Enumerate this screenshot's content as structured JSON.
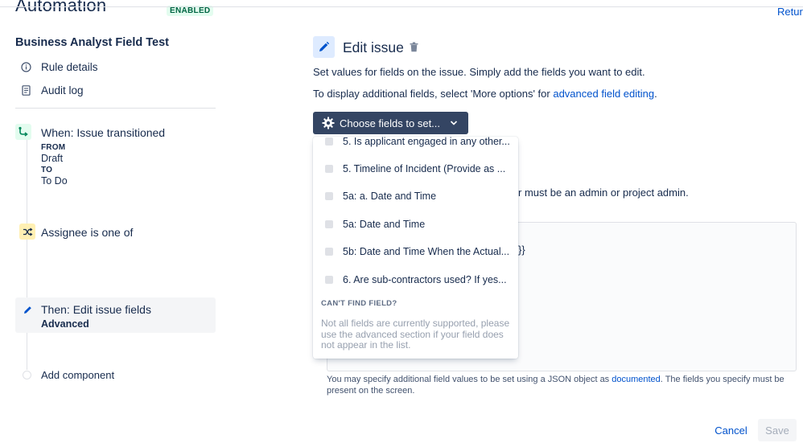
{
  "header": {
    "title": "Automation",
    "status_badge": "ENABLED",
    "return_link": "Retur"
  },
  "sidebar": {
    "rule_name": "Business Analyst Field Test",
    "links": [
      {
        "label": "Rule details",
        "icon": "info-icon"
      },
      {
        "label": "Audit log",
        "icon": "document-icon"
      }
    ],
    "trigger": {
      "title": "When: Issue transitioned",
      "from_caption": "FROM",
      "from_value": "Draft",
      "to_caption": "TO",
      "to_value": "To Do",
      "icon": "transition-icon"
    },
    "condition": {
      "title": "Assignee is one of",
      "icon": "shuffle-icon"
    },
    "action": {
      "title": "Then: Edit issue fields",
      "subtitle": "Advanced",
      "icon": "pencil-icon"
    },
    "add_component": "Add component"
  },
  "main": {
    "title": "Edit issue",
    "description_1": "Set values for fields on the issue. Simply add the fields you want to edit.",
    "description_2_prefix": "To display additional fields, select 'More options' for ",
    "description_2_link": "advanced field editing",
    "description_2_suffix": ".",
    "choose_fields_label": "Choose fields to set...",
    "obscured_text_1": "r must be an admin or project admin.",
    "obscured_text_2": "}}",
    "help_prefix": "You may specify additional field values to be set using a JSON object as ",
    "help_link": "documented",
    "help_suffix": ". The fields you specify must be present on the screen.",
    "cancel_label": "Cancel",
    "save_label": "Save"
  },
  "dropdown": {
    "options": [
      "5. Is applicant engaged in any other...",
      "5. Timeline of Incident (Provide as ...",
      "5a: a. Date and Time",
      "5a: Date and Time",
      "5b: Date and Time When the Actual...",
      "6. Are sub-contractors used? If yes..."
    ],
    "cant_find_heading": "CAN'T FIND FIELD?",
    "cant_find_note": "Not all fields are currently supported, please use the advanced section if your field does not appear in the list."
  },
  "colors": {
    "primary_button": "#344563",
    "link": "#0052cc",
    "enabled_green": "#006644",
    "condition_yellow": "#fff0b3",
    "trigger_green": "#e3fcef",
    "action_blue": "#deebff"
  }
}
